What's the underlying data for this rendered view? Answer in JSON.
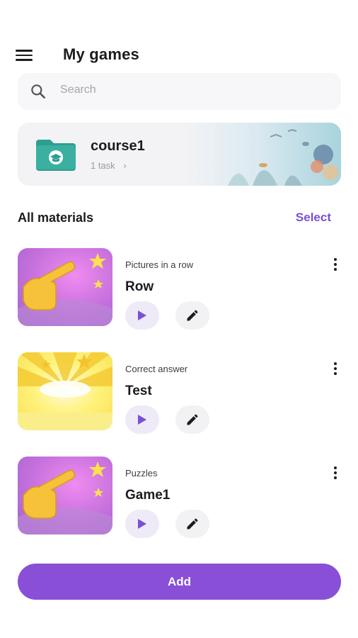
{
  "header": {
    "title": "My games"
  },
  "search": {
    "placeholder": "Search"
  },
  "course": {
    "name": "course1",
    "meta": "1 task"
  },
  "materials": {
    "section_title": "All materials",
    "select_label": "Select",
    "items": [
      {
        "category": "Pictures in a row",
        "name": "Row",
        "thumbnail": "pink-pointing-hand"
      },
      {
        "category": "Correct answer",
        "name": "Test",
        "thumbnail": "yellow-burst"
      },
      {
        "category": "Puzzles",
        "name": "Game1",
        "thumbnail": "pink-pointing-hand"
      }
    ]
  },
  "footer": {
    "add_label": "Add"
  },
  "colors": {
    "accent": "#8a4fd7",
    "play_bg": "#eeeaf7",
    "teal": "#2e9e8f"
  }
}
